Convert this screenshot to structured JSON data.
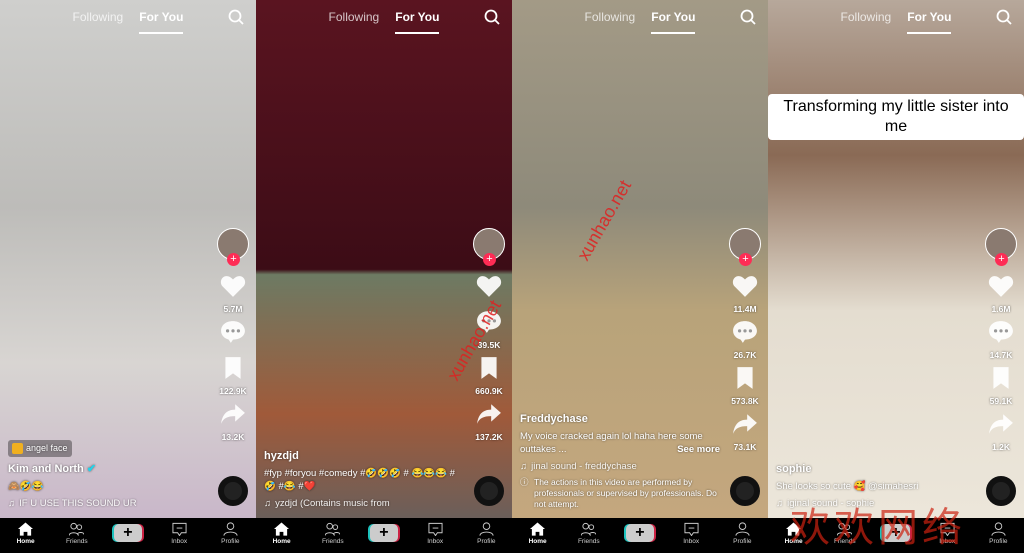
{
  "top_tabs": {
    "following": "Following",
    "for_you": "For You"
  },
  "nav": {
    "home": "Home",
    "friends": "Friends",
    "create": "+",
    "inbox": "Inbox",
    "profile": "Profile"
  },
  "colors": {
    "accent": "#fe2c55",
    "cyan": "#25f4ee",
    "nav_bg": "#000000"
  },
  "watermarks": [
    "xunhao.net",
    "xunhao.net",
    "欢欢网络"
  ],
  "panels": [
    {
      "effect": "angel face",
      "username": "Kim and North",
      "verified": true,
      "description": "🙈🤣😂",
      "music": "IF U USE THIS SOUND UR",
      "likes": "5.7M",
      "comments": "",
      "bookmarks": "122.9K",
      "shares": "13.2K",
      "see_more": "",
      "notice": "",
      "overlay": ""
    },
    {
      "effect": "",
      "username": "hyzdjd",
      "verified": false,
      "description": "#fyp #foryou #comedy #🤣🤣🤣 # 😂😂😂 #🤣 #😂 #❤️",
      "music": "yzdjd (Contains music from",
      "likes": "",
      "comments": "39.5K",
      "bookmarks": "660.9K",
      "shares": "137.2K",
      "see_more": "",
      "notice": "",
      "overlay": ""
    },
    {
      "effect": "",
      "username": "Freddychase",
      "verified": false,
      "description": "My voice cracked again lol haha here some outtakes ...",
      "music": "jinal sound - freddychase",
      "likes": "11.4M",
      "comments": "26.7K",
      "bookmarks": "573.8K",
      "shares": "73.1K",
      "see_more": "See more",
      "notice": "The actions in this video are performed by professionals or supervised by professionals. Do not attempt.",
      "overlay": ""
    },
    {
      "effect": "",
      "username": "sophie",
      "verified": false,
      "description": "She looks so cute 🥰 @simahesri",
      "music": "iginal sound - sophie",
      "likes": "1.6M",
      "comments": "14.7K",
      "bookmarks": "59.1K",
      "shares": "1.2K",
      "see_more": "",
      "notice": "",
      "overlay": "Transforming my little sister into me"
    }
  ]
}
